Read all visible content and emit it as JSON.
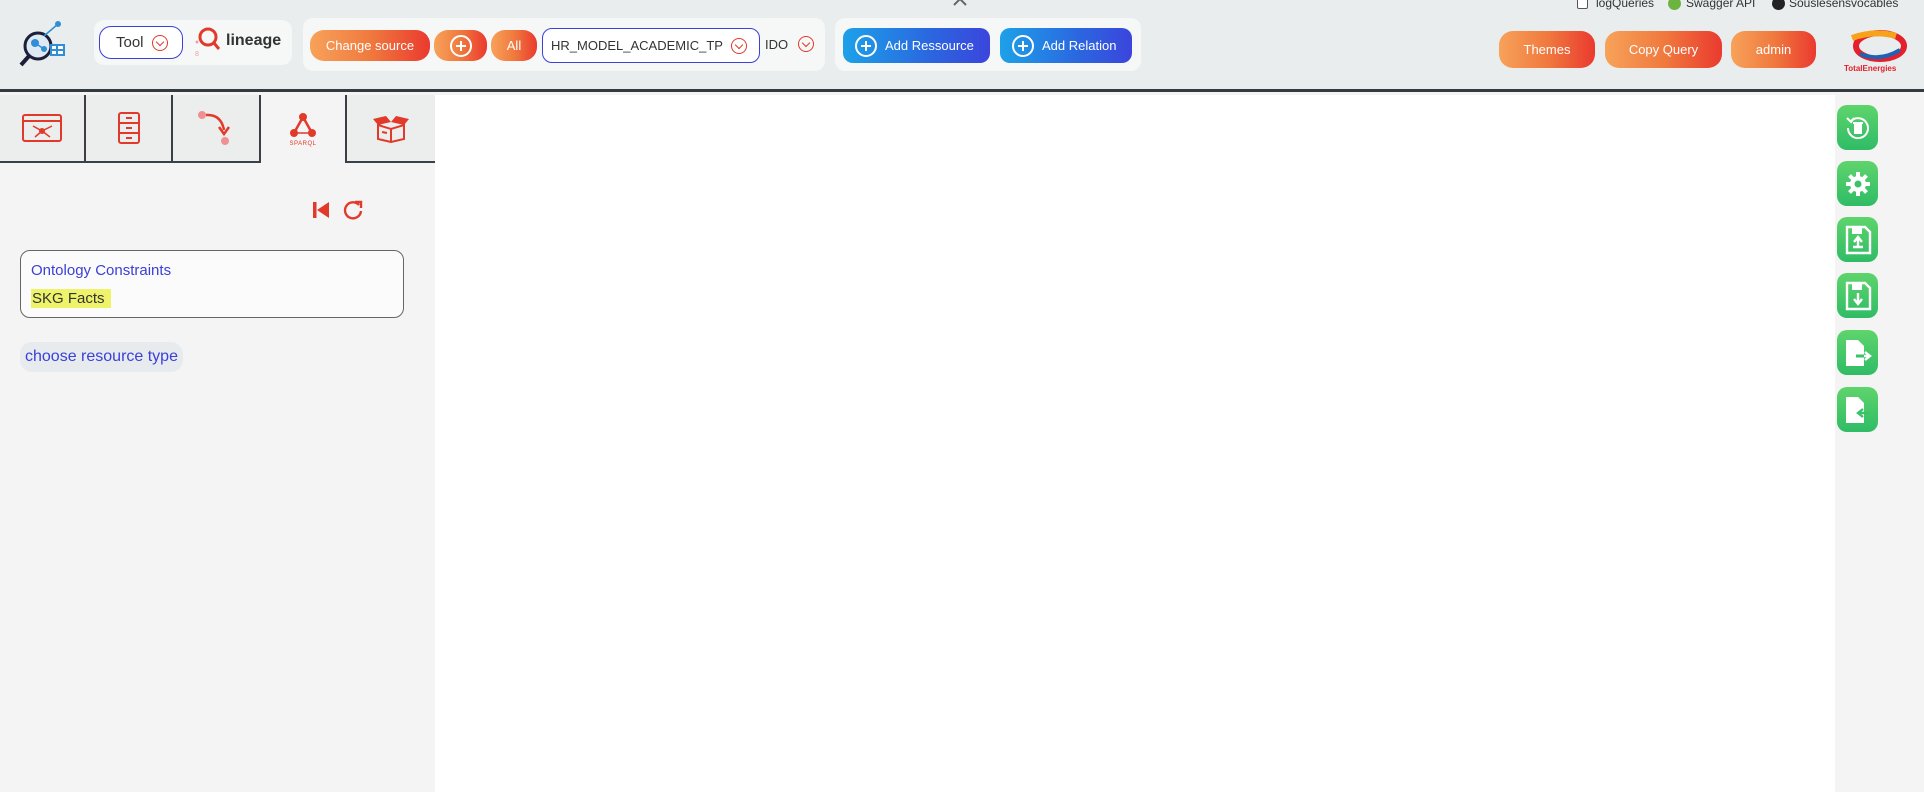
{
  "top_corner": {
    "log_queries_label": "logQueries",
    "swagger_label": "Swagger API",
    "github_label": "Souslesensvocables"
  },
  "header": {
    "tool_select_label": "Tool",
    "app_name": "lineage",
    "change_source_label": "Change source",
    "all_label": "All",
    "source_value": "HR_MODEL_ACADEMIC_TP",
    "ontology_value": "IDO",
    "add_resource_label": "Add Ressource",
    "add_relation_label": "Add Relation",
    "themes_label": "Themes",
    "copy_query_label": "Copy Query",
    "user_label": "admin",
    "brand_label": "TotalEnergies"
  },
  "tabs": [
    {
      "icon": "graph-window-icon"
    },
    {
      "icon": "file-cabinet-icon"
    },
    {
      "icon": "relation-arrow-icon"
    },
    {
      "icon": "sparql-icon",
      "label": "SPARQL",
      "active": true
    },
    {
      "icon": "open-box-icon"
    }
  ],
  "left_panel": {
    "constraint_items": [
      "Ontology Constraints",
      "SKG Facts"
    ],
    "choose_resource_label": "choose resource type"
  },
  "right_toolbar": [
    "trash-recycle-icon",
    "gear-icon",
    "save-upload-icon",
    "save-download-icon",
    "file-export-icon",
    "file-import-icon"
  ],
  "colors": {
    "accent_orange": "#f07a3e",
    "accent_red": "#e23a2a",
    "accent_blue": "#2b66e0",
    "tool_green": "#2fbc66",
    "highlight_yellow": "#eef36a",
    "link_blue": "#3a40d8"
  }
}
